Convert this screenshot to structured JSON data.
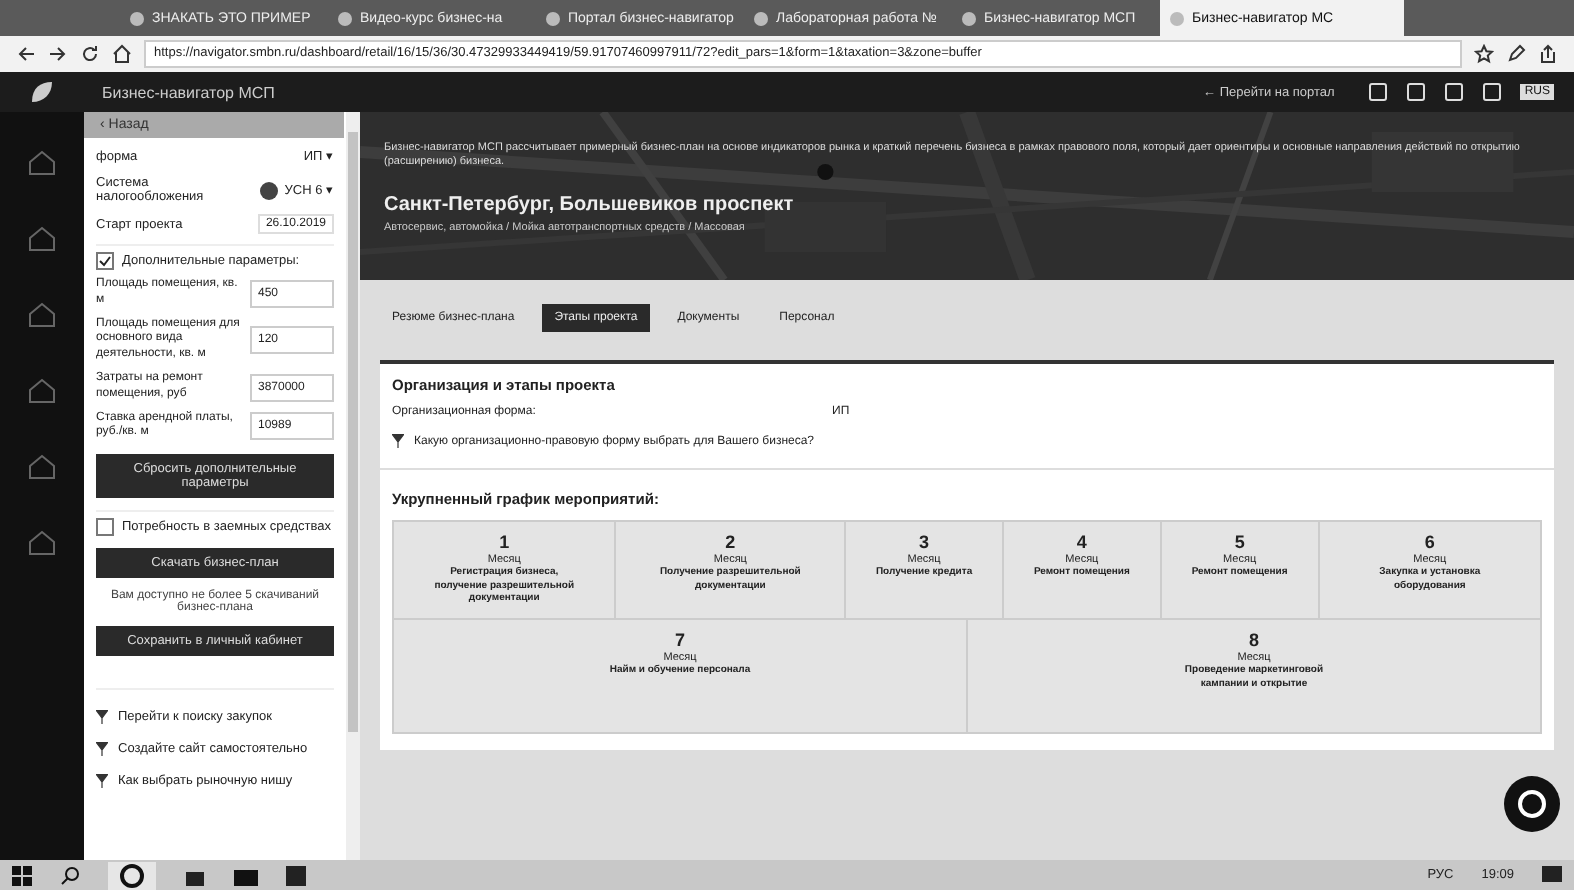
{
  "browser": {
    "tabs": [
      {
        "title": "ЗНАКАТЬ ЭТО ПРИМЕР",
        "selected": false
      },
      {
        "title": "Видео-курс бизнес-на",
        "selected": false
      },
      {
        "title": "Портал бизнес-навигатор",
        "selected": false
      },
      {
        "title": "Лабораторная работа №",
        "selected": false
      },
      {
        "title": "Бизнес-навигатор МСП",
        "selected": false
      },
      {
        "title": "Бизнес-навигатор МС",
        "selected": true
      }
    ],
    "address": "https://navigator.smbn.ru/dashboard/retail/16/15/36/30.47329933449419/59.91707460997911/72?edit_pars=1&form=1&taxation=3&zone=buffer"
  },
  "app": {
    "title": "Бизнес-навигатор МСП",
    "portal_link": "← Перейти на портал",
    "lang": "RUS"
  },
  "panel": {
    "back": "‹ Назад",
    "form_label": "форма",
    "form_value": "ИП ▾",
    "tax_label": "Система налогообложения",
    "tax_value": "УСН 6 ▾",
    "start_label": "Старт проекта",
    "start_value": "26.10.2019",
    "extra": {
      "label": "Дополнительные параметры:",
      "checked": true
    },
    "params": [
      {
        "label": "Площадь помещения, кв. м",
        "value": "450"
      },
      {
        "label": "Площадь помещения для основного вида деятельности, кв. м",
        "value": "120"
      },
      {
        "label": "Затраты на ремонт помещения, руб",
        "value": "3870000"
      },
      {
        "label": "Ставка арендной платы, руб./кв. м",
        "value": "10989"
      }
    ],
    "reset_button": "Сбросить дополнительные параметры",
    "loan": {
      "label": "Потребность в заемных средствах",
      "checked": false
    },
    "download_button": "Скачать бизнес-план",
    "download_note": "Вам доступно не более 5 скачиваний бизнес-плана",
    "save_button": "Сохранить в личный кабинет",
    "links": [
      "Перейти к поиску закупок",
      "Создайте сайт самостоятельно",
      "Как выбрать рыночную нишу"
    ]
  },
  "header": {
    "description": "Бизнес-навигатор МСП рассчитывает примерный бизнес-план на основе индикаторов рынка и краткий перечень бизнеса в рамках правового поля, который дает ориентиры и основные направления действий по открытию (расширению) бизнеса.",
    "city": "Санкт-Петербург, Большевиков проспект",
    "subtitle": "Автосервис, автомойка / Мойка автотранспортных средств / Массовая"
  },
  "tabs": [
    {
      "label": "Резюме бизнес-плана",
      "selected": false
    },
    {
      "label": "Этапы проекта",
      "selected": true
    },
    {
      "label": "Документы",
      "selected": false
    },
    {
      "label": "Персонал",
      "selected": false
    }
  ],
  "org": {
    "title": "Организация и этапы проекта",
    "form_label": "Организационная форма:",
    "form_value": "ИП",
    "link": "Какую организационно-правовую форму выбрать для Вашего бизнеса?"
  },
  "schedule": {
    "title": "Укрупненный график мероприятий:",
    "steps": [
      {
        "number": "1",
        "unit": "Месяц",
        "text": "Регистрация бизнеса, получение разрешительной документации"
      },
      {
        "number": "2",
        "unit": "Месяц",
        "text": "Получение разрешительной документации"
      },
      {
        "number": "3",
        "unit": "Месяц",
        "text": "Получение кредита"
      },
      {
        "number": "4",
        "unit": "Месяц",
        "text": "Ремонт помещения"
      },
      {
        "number": "5",
        "unit": "Месяц",
        "text": "Ремонт помещения"
      },
      {
        "number": "6",
        "unit": "Месяц",
        "text": "Закупка и установка оборудования"
      },
      {
        "number": "7",
        "unit": "Месяц",
        "text": "Найм и обучение персонала"
      },
      {
        "number": "8",
        "unit": "Месяц",
        "text": "Проведение маркетинговой кампании и открытие"
      }
    ]
  },
  "taskbar": {
    "lang": "РУС",
    "time": "19:09"
  }
}
